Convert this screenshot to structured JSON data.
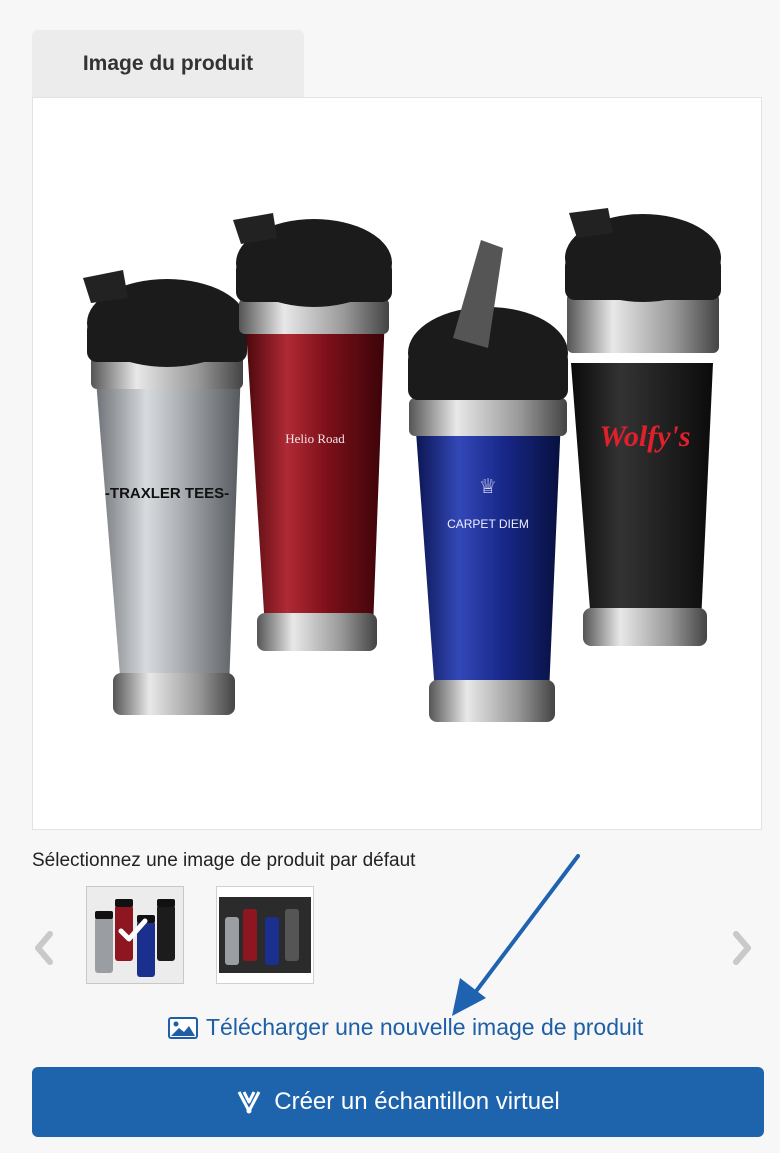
{
  "panel": {
    "tab_label": "Image du produit"
  },
  "product_image": {
    "tumblers": [
      {
        "color": "#9a9ea3",
        "print": "-TRAXLER TEES-"
      },
      {
        "color": "#8e1620",
        "print": "Helio Road"
      },
      {
        "color": "#1b2f8f",
        "print": "CARPET DIEM"
      },
      {
        "color": "#1c1c1c",
        "print": "Wolfy's"
      }
    ]
  },
  "default_image": {
    "label": "Sélectionnez une image de produit par défaut",
    "prev_icon": "chevron-left-icon",
    "next_icon": "chevron-right-icon",
    "selected_icon": "checkmark-icon"
  },
  "upload": {
    "icon": "image-icon",
    "label": "Télécharger une nouvelle image de produit"
  },
  "cta": {
    "icon": "virtual-sample-icon",
    "label": "Créer un échantillon virtuel",
    "color": "#1e64ad"
  }
}
